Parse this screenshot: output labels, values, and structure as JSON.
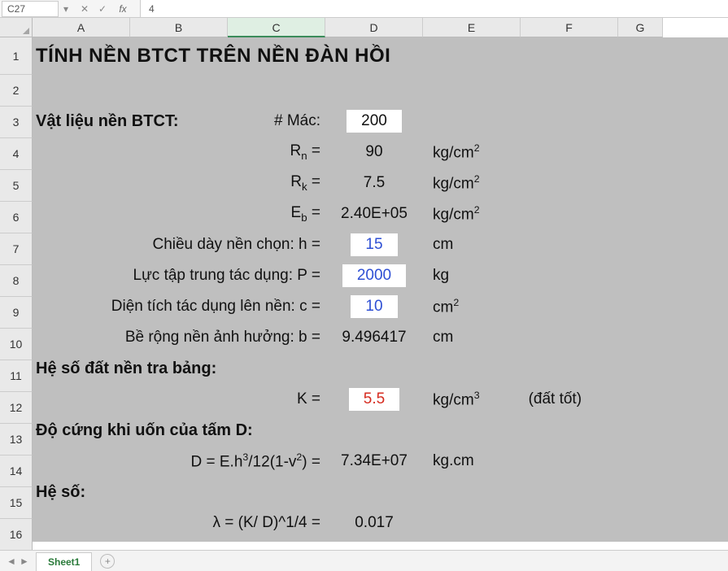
{
  "formula_bar": {
    "name_box": "C27",
    "value": "4"
  },
  "columns": [
    "A",
    "B",
    "C",
    "D",
    "E",
    "F",
    "G"
  ],
  "active_col": "C",
  "rows": [
    "1",
    "2",
    "3",
    "4",
    "5",
    "6",
    "7",
    "8",
    "9",
    "10",
    "11",
    "12",
    "13",
    "14",
    "15",
    "16"
  ],
  "title": "TÍNH NỀN BTCT TRÊN NỀN ĐÀN HỒI",
  "r3": {
    "label": "Vật liệu nền BTCT:",
    "mac_label": "# Mác:",
    "mac_val": "200"
  },
  "r4": {
    "sym": "R",
    "sub": "n",
    "val": "90",
    "unit": "kg/cm",
    "sup": "2"
  },
  "r5": {
    "sym": "R",
    "sub": "k",
    "val": "7.5",
    "unit": "kg/cm",
    "sup": "2"
  },
  "r6": {
    "sym": "E",
    "sub": "b",
    "val": "2.40E+05",
    "unit": "kg/cm",
    "sup": "2"
  },
  "r7": {
    "label": "Chiều dày nền chọn: h =",
    "val": "15",
    "unit": "cm"
  },
  "r8": {
    "label": "Lực tập trung tác dụng: P =",
    "val": "2000",
    "unit": "kg"
  },
  "r9": {
    "label": "Diện tích tác dụng lên nền: c =",
    "val": "10",
    "unit": "cm",
    "sup": "2"
  },
  "r10": {
    "label": "Bề rộng nền ảnh hưởng: b =",
    "val": "9.496417",
    "unit": "cm"
  },
  "r11": {
    "label": "Hệ số đất nền tra bảng:"
  },
  "r12": {
    "sym": "K =",
    "val": "5.5",
    "unit": "kg/cm",
    "sup": "3",
    "note": "(đất tốt)"
  },
  "r13": {
    "label": "Độ cứng khi uốn của tấm D:"
  },
  "r14": {
    "formula_pre": "D = E.h",
    "formula_post": "/12(1-v",
    "formula_end": ") =",
    "val": "7.34E+07",
    "unit": "kg.cm"
  },
  "r15": {
    "label": "Hệ số:"
  },
  "r16": {
    "formula": "λ = (K/ D)^1/4 =",
    "val": "0.017"
  },
  "tabs": {
    "sheet": "Sheet1",
    "plus": "+"
  }
}
